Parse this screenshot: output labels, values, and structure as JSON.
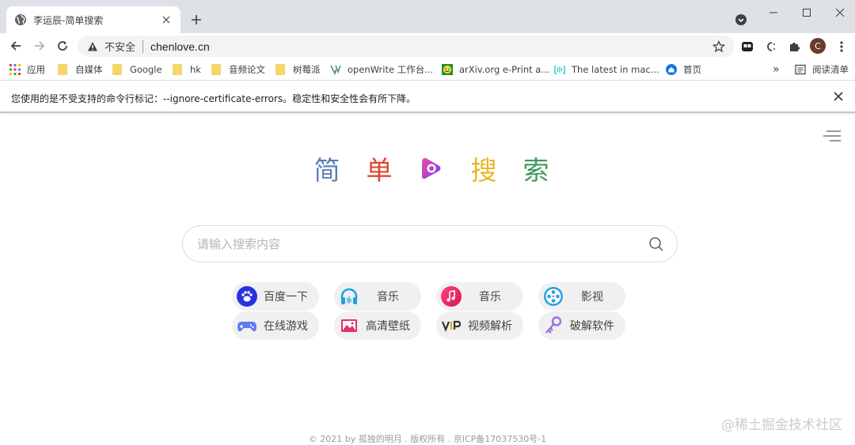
{
  "tab": {
    "title": "李运辰-简单搜索"
  },
  "omnibox": {
    "security_label": "不安全",
    "url": "chenlove.cn"
  },
  "bookmarks": [
    {
      "label": "应用",
      "icon": "apps-grid-icon"
    },
    {
      "label": "自媒体",
      "icon": "folder-icon"
    },
    {
      "label": "Google",
      "icon": "folder-icon"
    },
    {
      "label": "hk",
      "icon": "folder-icon"
    },
    {
      "label": "音频论文",
      "icon": "folder-icon"
    },
    {
      "label": "树莓派",
      "icon": "folder-icon"
    },
    {
      "label": "openWrite 工作台...",
      "icon": "openwrite-icon"
    },
    {
      "label": "arXiv.org e-Print a...",
      "icon": "arxiv-icon"
    },
    {
      "label": "The latest in mac...",
      "icon": "paperswithcode-icon"
    },
    {
      "label": "首页",
      "icon": "home-site-icon"
    }
  ],
  "bookmarks_more": "»",
  "reading_list": "阅读清单",
  "profile_initial": "C",
  "infobar": {
    "message": "您使用的是不受支持的命令行标记：--ignore-certificate-errors。稳定性和安全性会有所下降。"
  },
  "logo": {
    "chars": [
      "简",
      "单",
      "搜",
      "索"
    ],
    "colors": [
      "#5b7fb5",
      "#e0452f",
      "#e9b527",
      "#3d9a5b"
    ]
  },
  "search": {
    "placeholder": "请输入搜索内容"
  },
  "quick_links": [
    {
      "label": "百度一下",
      "icon": "baidu-icon"
    },
    {
      "label": "音乐",
      "icon": "headphones-icon"
    },
    {
      "label": "音乐",
      "icon": "music-note-icon"
    },
    {
      "label": "影视",
      "icon": "film-reel-icon"
    },
    {
      "label": "在线游戏",
      "icon": "gamepad-icon"
    },
    {
      "label": "高清壁纸",
      "icon": "image-icon"
    },
    {
      "label": "视频解析",
      "icon": "vip-icon"
    },
    {
      "label": "破解软件",
      "icon": "key-icon"
    }
  ],
  "footer": {
    "text": "© 2021 by 孤独的明月 . 版权所有 . 京ICP备17037530号-1"
  },
  "watermark": "@稀土掘金技术社区"
}
